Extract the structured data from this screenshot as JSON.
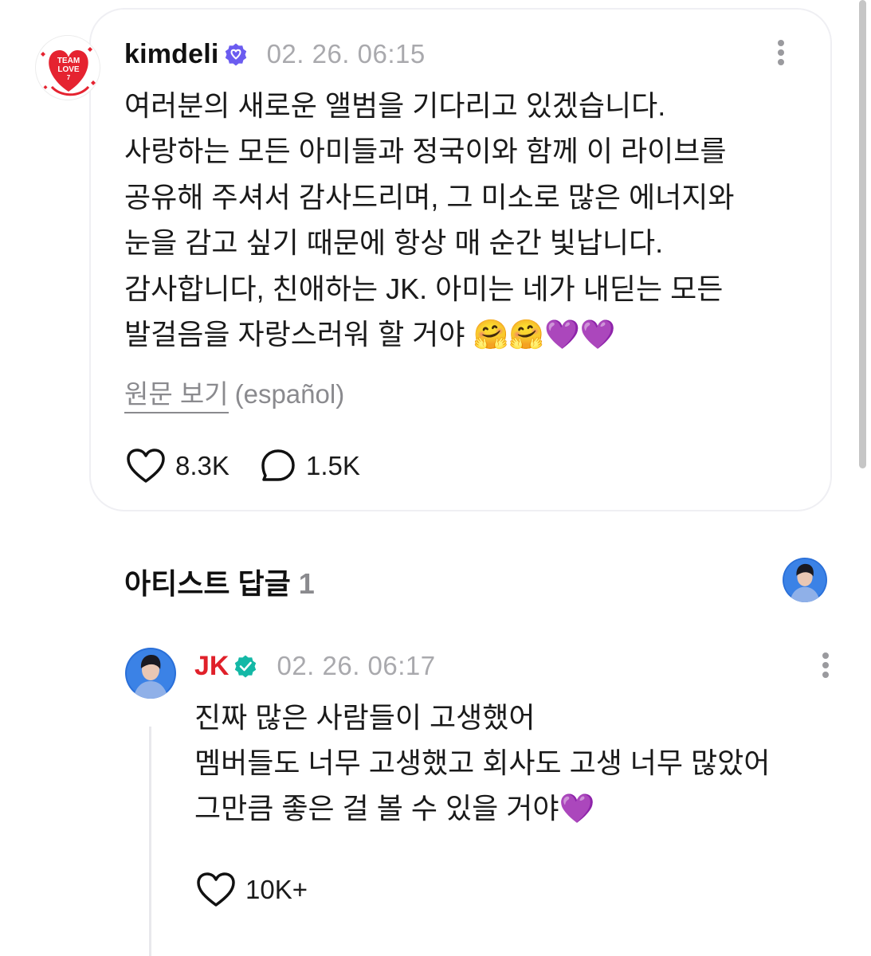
{
  "post": {
    "username": "kimdeli",
    "timestamp": "02. 26. 06:15",
    "avatar_text": [
      "TEAM",
      "LOVE",
      "7"
    ],
    "body": "여러분의 새로운 앨범을 기다리고 있겠습니다.\n사랑하는 모든 아미들과 정국이와 함께 이 라이브를\n공유해 주셔서 감사드리며, 그 미소로 많은 에너지와\n눈을 감고 싶기 때문에 항상 매 순간 빛납니다.\n감사합니다, 친애하는 JK. 아미는 네가 내딛는 모든\n발걸음을 자랑스러워 할 거야 🤗🤗💜💜",
    "translation_link": "원문 보기",
    "translation_lang": "(español)",
    "likes": "8.3K",
    "comments": "1.5K"
  },
  "artist_replies": {
    "title": "아티스트 답글",
    "count": "1"
  },
  "reply": {
    "artist_name": "JK",
    "timestamp": "02. 26. 06:17",
    "body": "진짜 많은 사람들이 고생했어\n멤버들도 너무 고생했고 회사도 고생 너무 많았어\n그만큼 좋은 걸 볼 수 있을 거야💜",
    "likes": "10K+"
  },
  "colors": {
    "verified_user": "#6b5cf0",
    "verified_artist": "#14b8a6",
    "artist_name": "#e0202a",
    "muted_text": "#a9a9ad"
  },
  "icons": {
    "verified": "verified-badge-icon",
    "more": "more-vertical-icon",
    "like": "heart-outline-icon",
    "comment": "speech-bubble-icon"
  }
}
